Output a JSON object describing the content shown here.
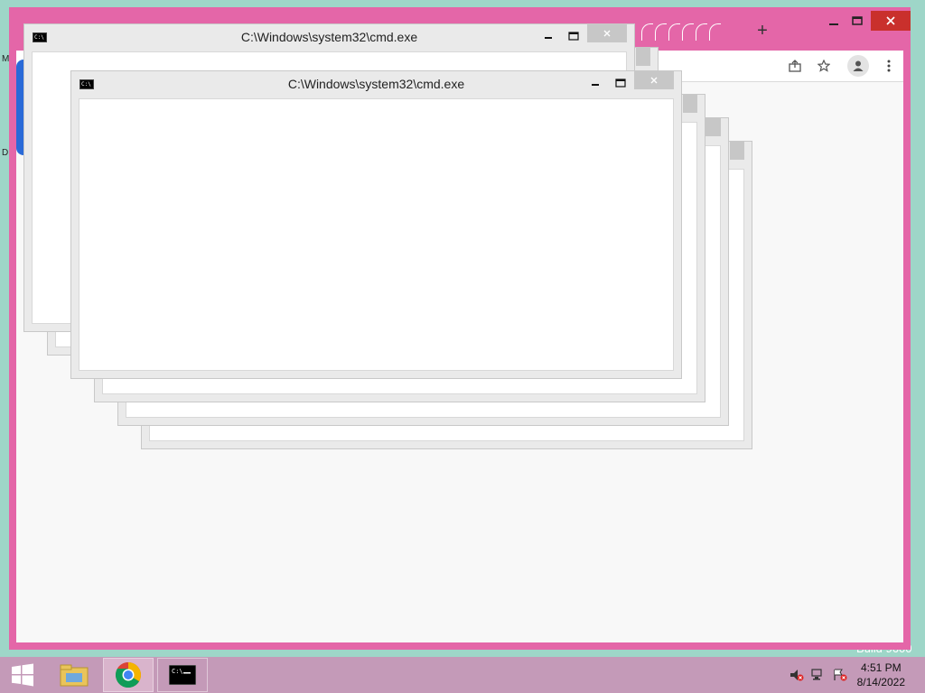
{
  "desktop": {
    "watermark_fragment": "Build 9600",
    "edge_letter_1": "M",
    "edge_letter_2": "D"
  },
  "chrome": {
    "toolbar_icons": [
      "share-icon",
      "star-icon",
      "profile-icon",
      "menu-dots-icon"
    ],
    "new_tab_label": "+",
    "window_controls": [
      "minimize",
      "maximize",
      "close"
    ]
  },
  "cmd_windows": [
    {
      "title": "C:\\Windows\\system32\\cmd.exe"
    },
    {
      "title": "C:\\Windows\\system32\\cmd.exe"
    }
  ],
  "taskbar": {
    "apps": [
      "start-icon",
      "file-explorer-icon",
      "chrome-icon",
      "cmd-icon"
    ],
    "time": "4:51 PM",
    "date": "8/14/2022",
    "tray": [
      "volume-muted-icon",
      "network-icon",
      "action-center-icon"
    ]
  }
}
